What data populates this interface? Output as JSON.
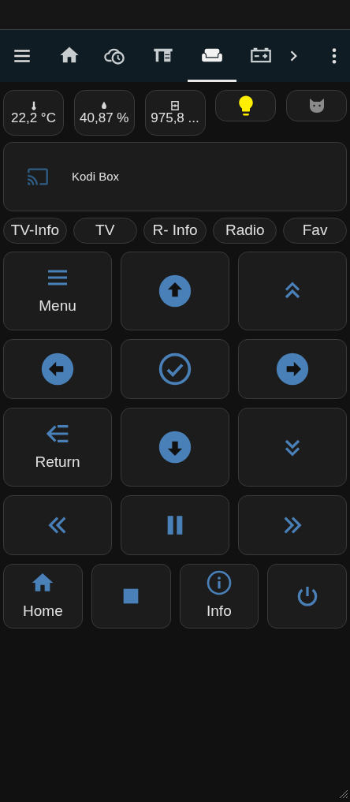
{
  "tabs": [
    {
      "kind": "home",
      "selected": false
    },
    {
      "kind": "cloud-clock",
      "selected": false
    },
    {
      "kind": "desk",
      "selected": false
    },
    {
      "kind": "sofa",
      "selected": true
    },
    {
      "kind": "battery",
      "selected": false
    }
  ],
  "chips": [
    {
      "kind": "thermometer",
      "value": "22,2 °C"
    },
    {
      "kind": "drop",
      "value": "40,87 %"
    },
    {
      "kind": "gauge",
      "value": "975,8 ..."
    },
    {
      "kind": "bulb",
      "on": true
    },
    {
      "kind": "cat",
      "on": false
    }
  ],
  "media": {
    "name": "Kodi Box"
  },
  "pills": [
    "TV-Info",
    "TV",
    "R- Info",
    "Radio",
    "Fav"
  ],
  "remote_rows": [
    [
      {
        "kind": "menu",
        "label": "Menu"
      },
      {
        "kind": "arrow-up"
      },
      {
        "kind": "chevrons-up"
      }
    ],
    [
      {
        "kind": "arrow-left"
      },
      {
        "kind": "check"
      },
      {
        "kind": "arrow-right"
      }
    ],
    [
      {
        "kind": "return",
        "label": "Return"
      },
      {
        "kind": "arrow-down"
      },
      {
        "kind": "chevrons-down"
      }
    ],
    [
      {
        "kind": "rewind"
      },
      {
        "kind": "pause"
      },
      {
        "kind": "forward"
      }
    ],
    [
      {
        "kind": "home",
        "label": "Home"
      },
      {
        "kind": "stop"
      },
      {
        "kind": "info",
        "label": "Info"
      },
      {
        "kind": "power"
      }
    ]
  ]
}
